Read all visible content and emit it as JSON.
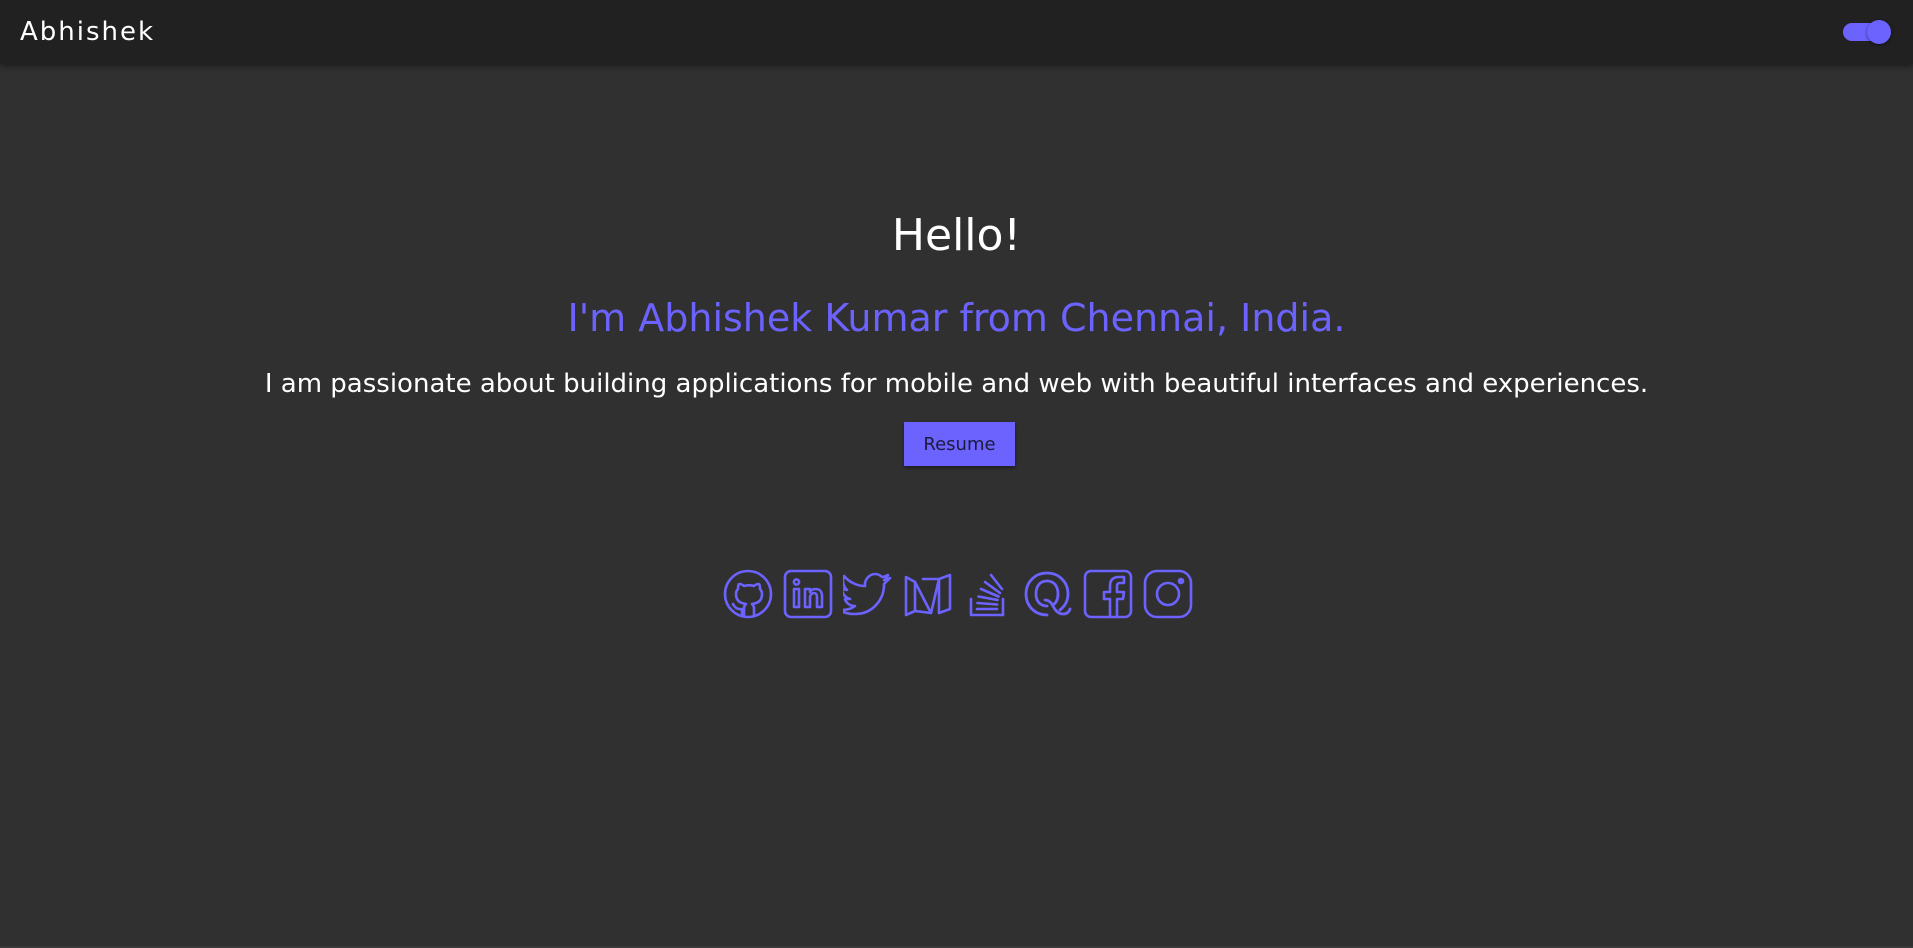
{
  "navbar": {
    "brand": "Abhishek",
    "theme_toggle": {
      "state": "on",
      "accent": "#6c63ff"
    }
  },
  "hero": {
    "greeting": "Hello!",
    "intro": "I'm Abhishek Kumar from Chennai, India.",
    "tagline": "I am passionate about building applications for mobile and web with beautiful interfaces and experiences.",
    "resume_label": "Resume"
  },
  "socials": [
    {
      "name": "github",
      "icon": "github-icon"
    },
    {
      "name": "linkedin",
      "icon": "linkedin-icon"
    },
    {
      "name": "twitter",
      "icon": "twitter-icon"
    },
    {
      "name": "medium",
      "icon": "medium-icon"
    },
    {
      "name": "stackoverflow",
      "icon": "stackoverflow-icon"
    },
    {
      "name": "quora",
      "icon": "quora-icon"
    },
    {
      "name": "facebook",
      "icon": "facebook-icon"
    },
    {
      "name": "instagram",
      "icon": "instagram-icon"
    }
  ],
  "colors": {
    "background": "#303030",
    "navbar": "#212121",
    "accent": "#6c63ff",
    "text": "#ffffff"
  }
}
